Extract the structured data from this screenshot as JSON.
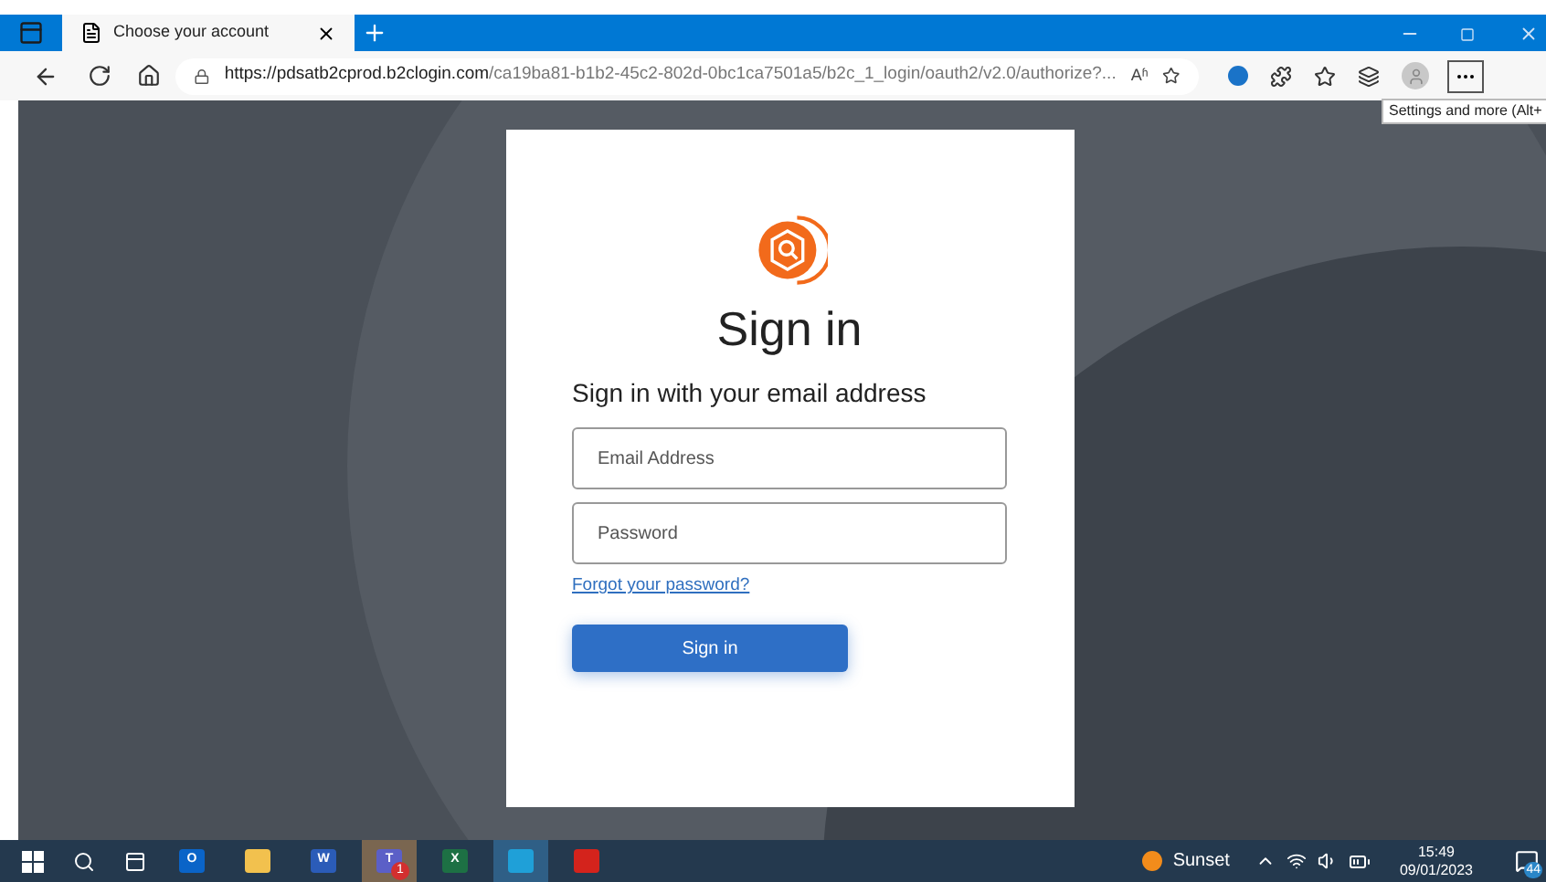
{
  "tab": {
    "title": "Choose your account",
    "selected": true
  },
  "address_bar": {
    "host": "https://pdsatb2cprod.b2clogin.com",
    "path": "/ca19ba81-b1b2-45c2-802d-0bc1ca7501a5/b2c_1_login/oauth2/v2.0/authorize?...",
    "read_aloud": "Aʱ"
  },
  "tooltip": "Settings and more (Alt+",
  "sign_in": {
    "title": "Sign in",
    "subtitle": "Sign in with your email address",
    "email": {
      "placeholder": "Email Address"
    },
    "password": {
      "placeholder": "Password"
    },
    "forgot_link": "Forgot your password?",
    "button": "Sign in"
  },
  "taskbar": {
    "apps": [
      {
        "kind": "outlook",
        "active": false,
        "glyph": "O"
      },
      {
        "kind": "explorer",
        "active": false
      },
      {
        "kind": "word",
        "active": false,
        "glyph": "W"
      },
      {
        "kind": "teams",
        "active": true,
        "badge": "1",
        "glyph": "T"
      },
      {
        "kind": "excel",
        "active": false,
        "glyph": "X"
      },
      {
        "kind": "edge",
        "active": true
      },
      {
        "kind": "acrobat",
        "active": false
      }
    ],
    "weather": "Sunset",
    "time": "15:49",
    "date": "09/01/2023",
    "notifications": "44"
  }
}
